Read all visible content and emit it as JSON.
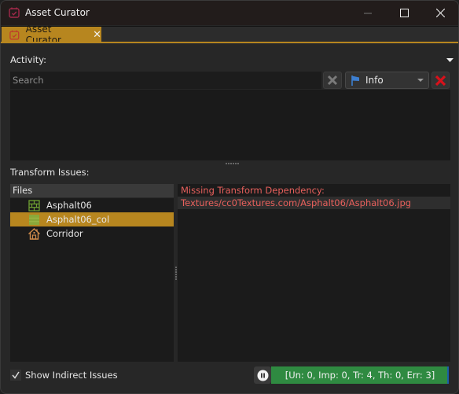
{
  "window": {
    "title": "Asset Curator",
    "controls": [
      "minimize",
      "maximize",
      "close"
    ]
  },
  "tabs": [
    {
      "label": "Asset Curator",
      "active": true,
      "closable": true
    }
  ],
  "activity": {
    "label": "Activity:",
    "search_placeholder": "Search",
    "search_value": "",
    "level_filter": "Info",
    "log_entries": []
  },
  "transform_issues": {
    "label": "Transform Issues:",
    "files_header": "Files",
    "files": [
      {
        "name": "Asphalt06",
        "icon": "texture-icon",
        "selected": false
      },
      {
        "name": "Asphalt06_col",
        "icon": "texture-icon",
        "selected": true
      },
      {
        "name": "Corridor",
        "icon": "house-icon",
        "selected": false
      }
    ],
    "details": [
      "Missing Transform Dependency:",
      "Textures/cc0Textures.com/Asphalt06/Asphalt06.jpg"
    ]
  },
  "footer": {
    "show_indirect_label": "Show Indirect Issues",
    "show_indirect_checked": true,
    "status_text": "[Un: 0, Imp: 0, Tr: 4, Th: 0, Err: 3]"
  },
  "colors": {
    "accent": "#b7861f",
    "error_text": "#e8605c",
    "status_ok": "#2f8a41",
    "icon_red": "#c8102e"
  }
}
